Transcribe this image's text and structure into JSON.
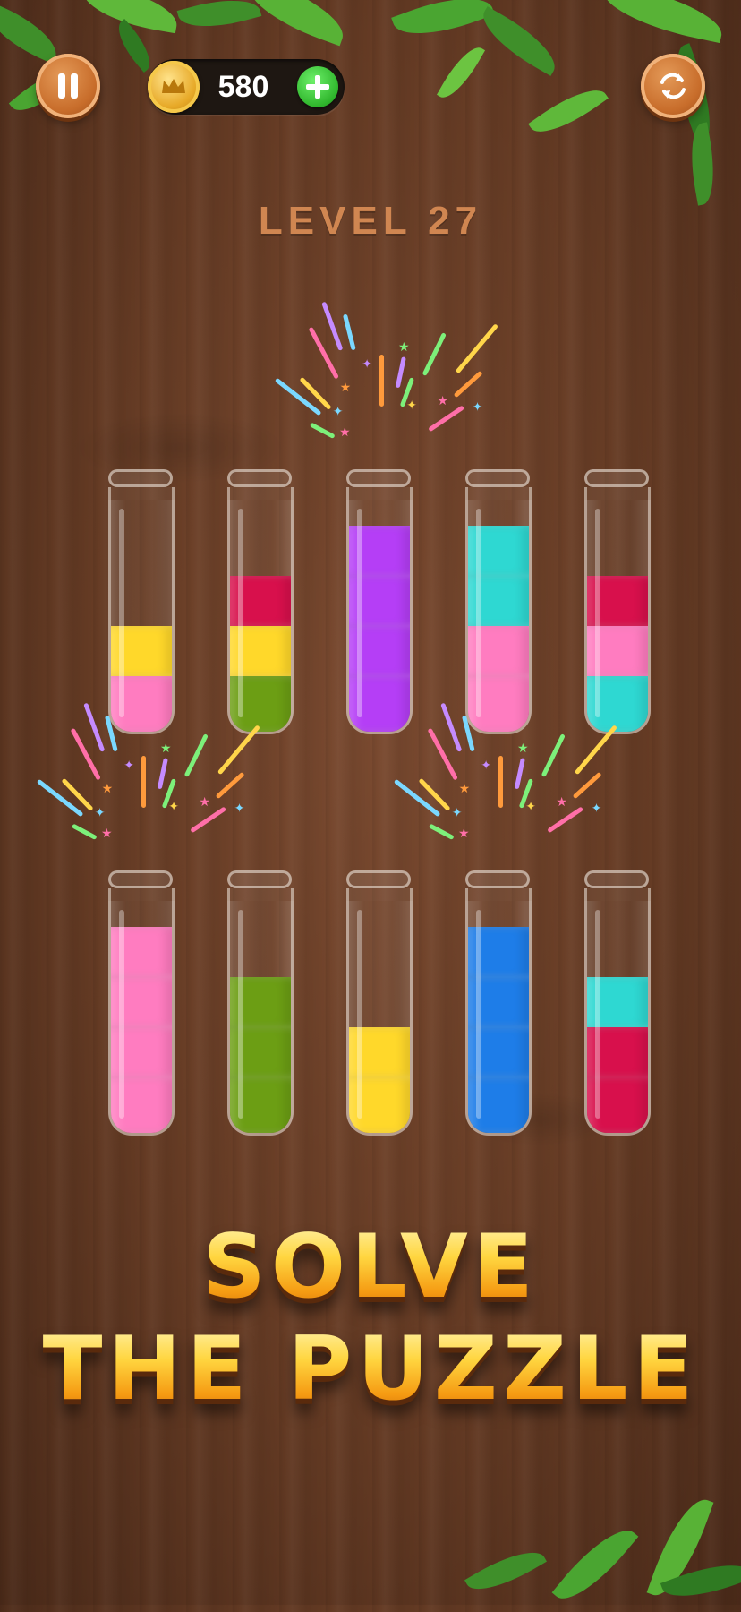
{
  "hud": {
    "pause_icon": "pause-icon",
    "coins": "580",
    "coin_icon": "crown-coin-icon",
    "add_coins_icon": "plus-icon",
    "restart_icon": "restart-icon"
  },
  "level": {
    "label": "LEVEL 27"
  },
  "colors": {
    "yellow": "#ffd82a",
    "pink": "#ff7cc0",
    "red": "#d8104c",
    "green": "#6c9e14",
    "purple": "#b53ef6",
    "cyan": "#2ed8d2",
    "blue": "#1e7de8"
  },
  "tubes": [
    {
      "id": 1,
      "layers_bottom_to_top": [
        "pink",
        "yellow"
      ],
      "completed": false
    },
    {
      "id": 2,
      "layers_bottom_to_top": [
        "green",
        "yellow",
        "red"
      ],
      "completed": false
    },
    {
      "id": 3,
      "layers_bottom_to_top": [
        "purple",
        "purple",
        "purple",
        "purple"
      ],
      "completed": true
    },
    {
      "id": 4,
      "layers_bottom_to_top": [
        "pink",
        "pink",
        "cyan",
        "cyan"
      ],
      "completed": false
    },
    {
      "id": 5,
      "layers_bottom_to_top": [
        "cyan",
        "pink",
        "red"
      ],
      "completed": false
    },
    {
      "id": 6,
      "layers_bottom_to_top": [
        "pink",
        "pink",
        "pink",
        "pink"
      ],
      "completed": true
    },
    {
      "id": 7,
      "layers_bottom_to_top": [
        "green",
        "green",
        "green"
      ],
      "completed": false
    },
    {
      "id": 8,
      "layers_bottom_to_top": [
        "yellow",
        "yellow"
      ],
      "completed": false
    },
    {
      "id": 9,
      "layers_bottom_to_top": [
        "blue",
        "blue",
        "blue",
        "blue"
      ],
      "completed": true
    },
    {
      "id": 10,
      "layers_bottom_to_top": [
        "red",
        "red",
        "cyan"
      ],
      "completed": false
    }
  ],
  "headline": {
    "line1": "SOLVE",
    "line2": "THE PUZZLE"
  }
}
